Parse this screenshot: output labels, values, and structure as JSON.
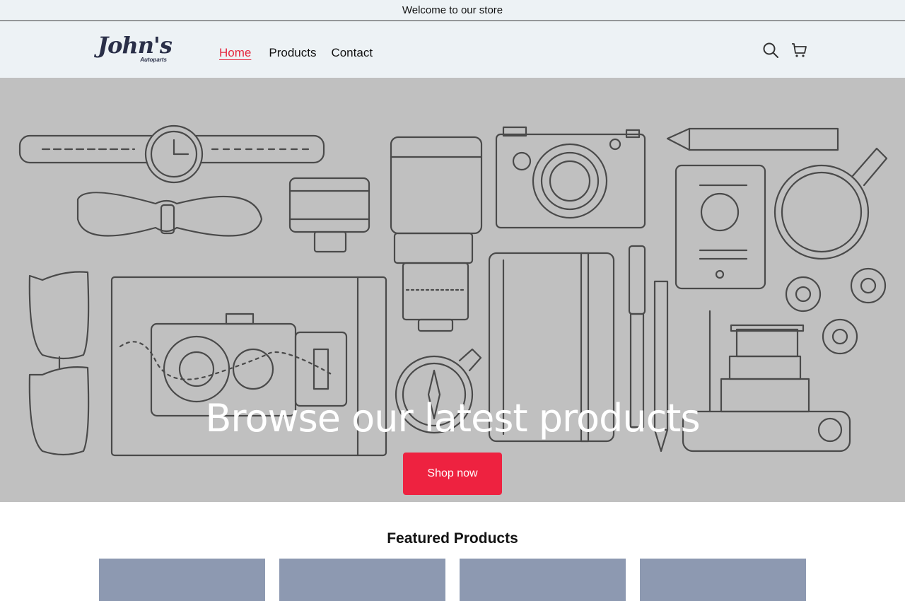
{
  "announcement": "Welcome to our store",
  "brand": {
    "name": "John's",
    "tagline": "Autoparts",
    "color": "#2a2f48"
  },
  "nav": [
    {
      "label": "Home",
      "active": true
    },
    {
      "label": "Products",
      "active": false
    },
    {
      "label": "Contact",
      "active": false
    }
  ],
  "header_icons": [
    "search-icon",
    "cart-icon"
  ],
  "hero": {
    "title": "Browse our latest products",
    "cta": "Shop now",
    "cta_color": "#ee2240"
  },
  "featured": {
    "title": "Featured Products",
    "card_color": "#8d99b1"
  },
  "accent": "#e5253d"
}
